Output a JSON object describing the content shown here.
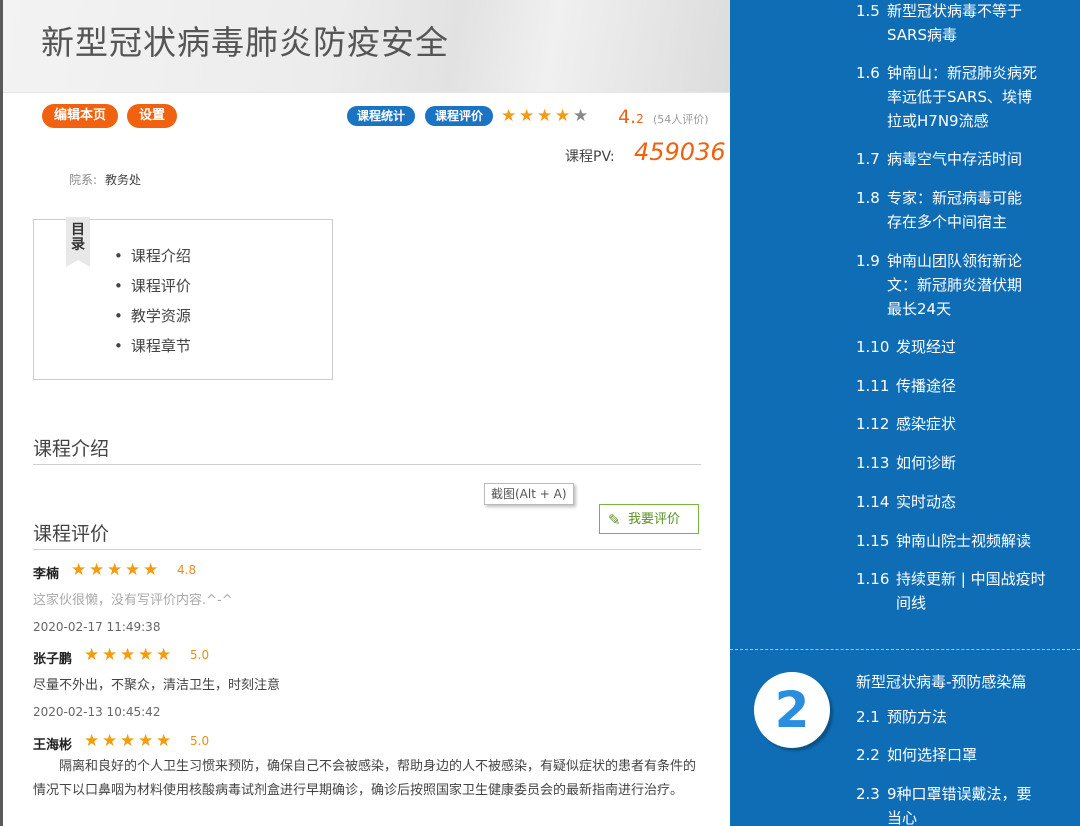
{
  "banner": {
    "title": "新型冠状病毒肺炎防疫安全"
  },
  "toolbar": {
    "edit_label": "编辑本页",
    "settings_label": "设置",
    "stats_label": "课程统计",
    "evaluate_label": "课程评价",
    "rating_main": "4.",
    "rating_decimal": "2",
    "rating_count": "(54人评价)",
    "rating_stars": 4
  },
  "pv": {
    "label": "课程PV:",
    "value": "459036"
  },
  "dept": {
    "label": "院系:",
    "value": "教务处"
  },
  "toc": {
    "tag": "目录",
    "items": [
      "课程介绍",
      "课程评价",
      "教学资源",
      "课程章节"
    ]
  },
  "sections": {
    "intro_title": "课程介绍",
    "reviews_title": "课程评价"
  },
  "screenshot_tip": "截图(Alt + A)",
  "review_button": "我要评价",
  "reviews": [
    {
      "name": "李楠",
      "score": "4.8",
      "text": "这家伙很懒，没有写评价内容.^-^",
      "time": "2020-02-17 11:49:38"
    },
    {
      "name": "张子鹏",
      "score": "5.0",
      "text": "尽量不外出，不聚众，清洁卫生，时刻注意",
      "time": "2020-02-13 10:45:42"
    },
    {
      "name": "王海彬",
      "score": "5.0",
      "text": "隔离和良好的个人卫生习惯来预防，确保自己不会被感染，帮助身边的人不被感染，有疑似症状的患者有条件的情况下以口鼻咽为材料使用核酸病毒试剂盒进行早期确诊，确诊后按照国家卫生健康委员会的最新指南进行治疗。"
    }
  ],
  "sidebar": {
    "items": [
      {
        "num": "1.5",
        "text": "新型冠状病毒不等于SARS病毒"
      },
      {
        "num": "1.6",
        "text": "钟南山：新冠肺炎病死率远低于SARS、埃博拉或H7N9流感"
      },
      {
        "num": "1.7",
        "text": "病毒空气中存活时间"
      },
      {
        "num": "1.8",
        "text": "专家：新冠病毒可能存在多个中间宿主"
      },
      {
        "num": "1.9",
        "text": "钟南山团队领衔新论文：新冠肺炎潜伏期最长24天"
      },
      {
        "num": "1.10",
        "text": "发现经过"
      },
      {
        "num": "1.11",
        "text": "传播途径"
      },
      {
        "num": "1.12",
        "text": "感染症状"
      },
      {
        "num": "1.13",
        "text": "如何诊断"
      },
      {
        "num": "1.14",
        "text": "实时动态"
      },
      {
        "num": "1.15",
        "text": "钟南山院士视频解读"
      },
      {
        "num": "1.16",
        "text": "持续更新 | 中国战疫时间线"
      }
    ],
    "chapter2": {
      "number": "2",
      "title": "新型冠状病毒-预防感染篇",
      "items": [
        {
          "num": "2.1",
          "text": "预防方法"
        },
        {
          "num": "2.2",
          "text": "如何选择口罩"
        },
        {
          "num": "2.3",
          "text": "9种口罩错误戴法，要当心"
        }
      ]
    }
  },
  "colors": {
    "accent_orange": "#f06210",
    "accent_blue": "#1b73c3",
    "sidebar_bg": "#0f6db5",
    "star": "#f39c12"
  }
}
